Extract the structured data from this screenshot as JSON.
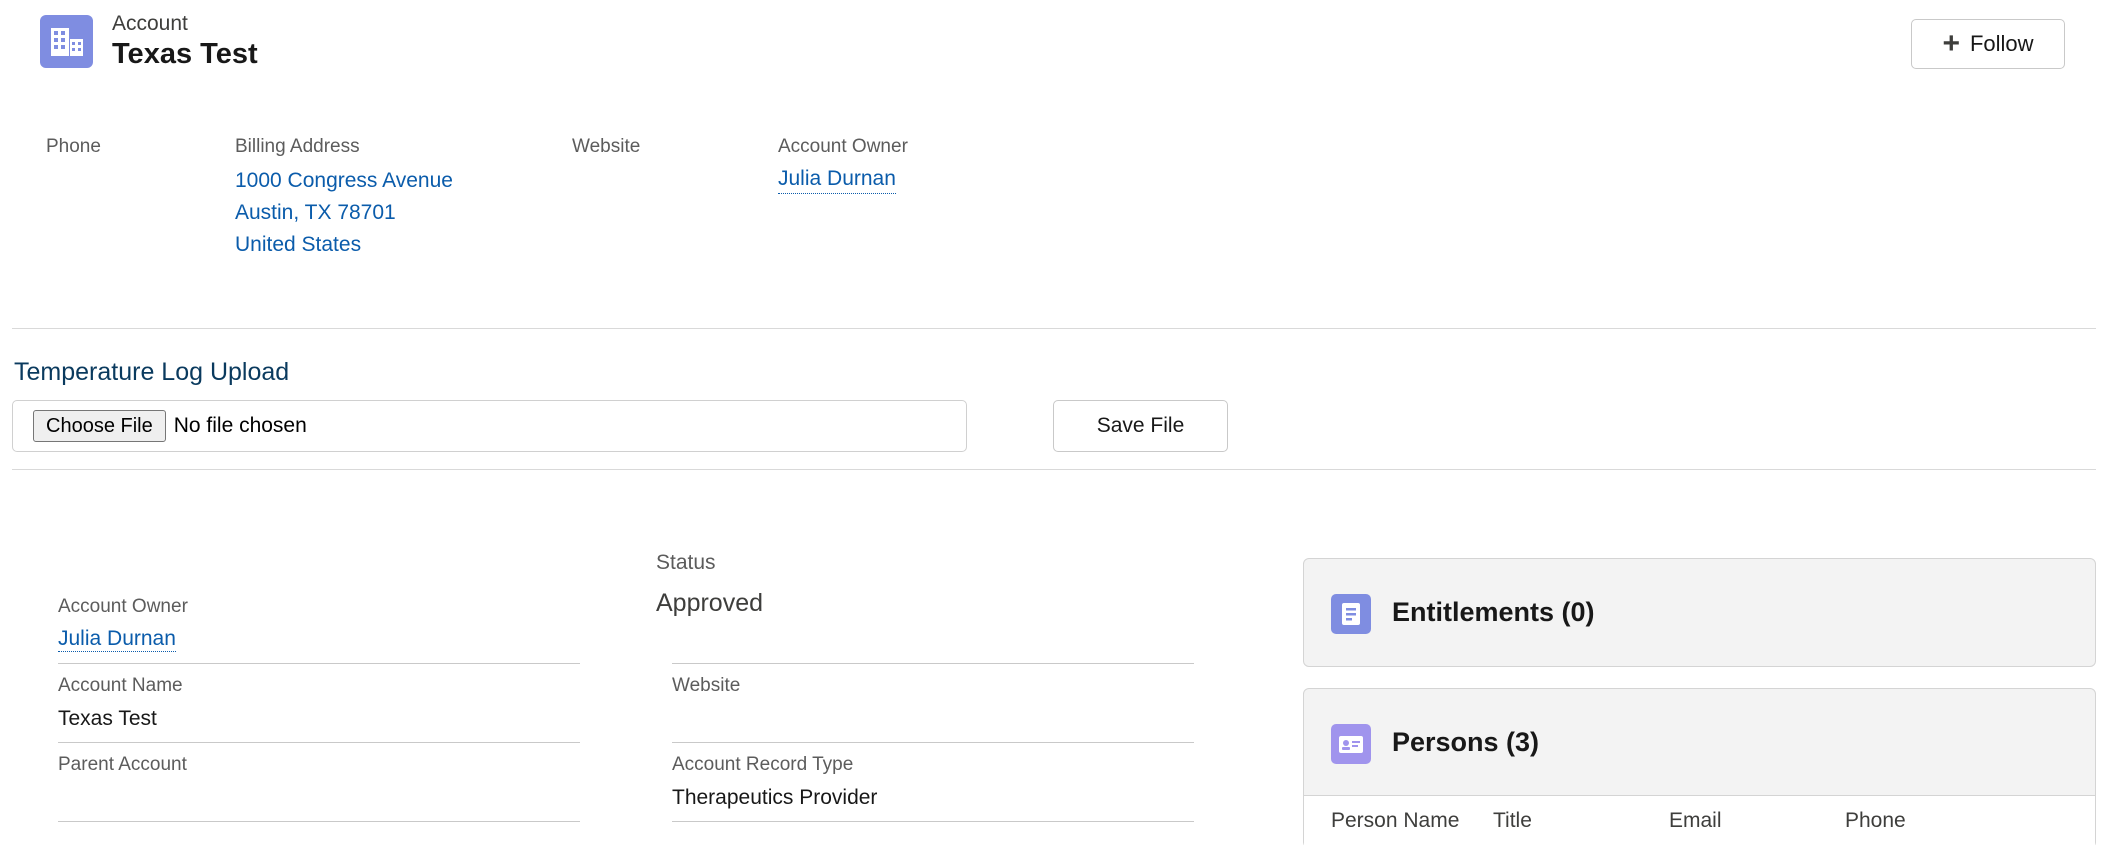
{
  "header": {
    "object_type": "Account",
    "title": "Texas Test",
    "follow_label": "Follow",
    "icon": "account-icon"
  },
  "highlights": {
    "phone_label": "Phone",
    "billing_label": "Billing Address",
    "billing_line1": "1000 Congress Avenue",
    "billing_line2": "Austin, TX 78701",
    "billing_line3": "United States",
    "website_label": "Website",
    "owner_label": "Account Owner",
    "owner_value": "Julia Durnan"
  },
  "upload": {
    "title": "Temperature Log Upload",
    "choose_label": "Choose File",
    "file_status": "No file chosen",
    "save_label": "Save File"
  },
  "details": {
    "status_label": "Status",
    "status_value": "Approved",
    "owner_label": "Account Owner",
    "owner_value": "Julia Durnan",
    "website_label": "Website",
    "website_value": "",
    "name_label": "Account Name",
    "name_value": "Texas Test",
    "parent_label": "Parent Account",
    "parent_value": "",
    "record_type_label": "Account Record Type",
    "record_type_value": "Therapeutics Provider"
  },
  "related": {
    "entitlements_title": "Entitlements (0)",
    "persons_title": "Persons (3)",
    "persons_columns": [
      "Person Name",
      "Title",
      "Email",
      "Phone"
    ]
  },
  "colors": {
    "account_icon": "#7f8de1",
    "entitlement_icon": "#7f8de1",
    "persons_icon": "#a094ed",
    "link": "#0b5cab"
  }
}
